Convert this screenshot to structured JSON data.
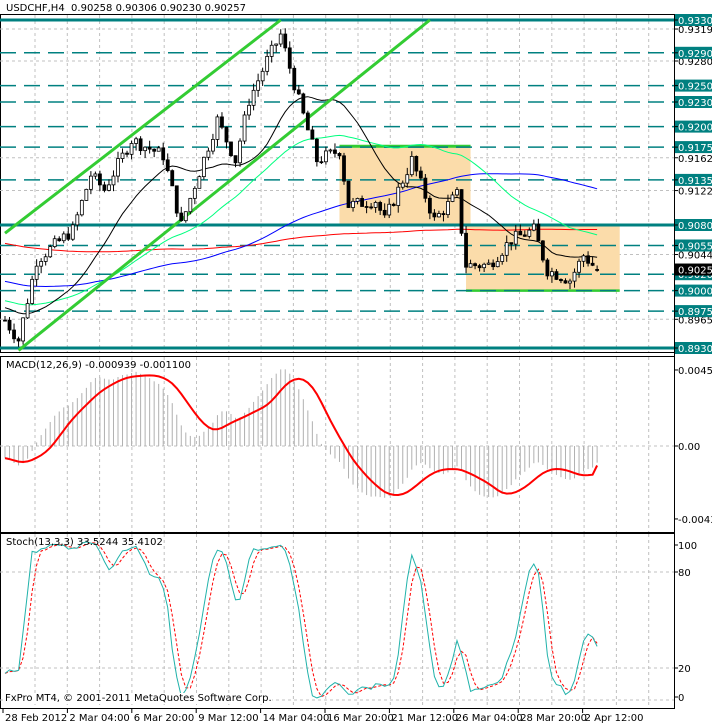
{
  "header": {
    "symbol": "USDCHF,H4",
    "ohlc": "0.90258 0.90306 0.90230 0.90257"
  },
  "macd_label": "MACD(12,26,9) -0.000939 -0.001100",
  "stoch_label": "Stoch(13,3,3) 33.5244 35.4102",
  "copyright": "FxPro MT4, © 2001-2011 MetaQuotes Software Corp.",
  "colors": {
    "level": "#008080",
    "channel": "#33cc33",
    "box": "#fbdcaa",
    "ma_fast": "#000000",
    "ma_mid": "#00ff7f",
    "ma_slow": "#0000ff",
    "ma_slowest": "#ff0000",
    "macd_signal": "#ff0000",
    "stoch_main": "#20b2aa",
    "stoch_signal": "#ff0000"
  },
  "chart_data": [
    {
      "type": "candlestick",
      "title": "USDCHF,H4",
      "last_bar": {
        "open": 0.90258,
        "high": 0.90306,
        "low": 0.9023,
        "close": 0.90257
      },
      "ylim": [
        0.893,
        0.933
      ],
      "x_tick_labels": [
        "28 Feb 2012",
        "2 Mar 04:00",
        "6 Mar 20:00",
        "9 Mar 12:00",
        "14 Mar 04:00",
        "16 Mar 20:00",
        "21 Mar 12:00",
        "26 Mar 04:00",
        "28 Mar 20:00",
        "2 Apr 12:00"
      ],
      "close_path": [
        [
          0,
          0.8964
        ],
        [
          3,
          0.894
        ],
        [
          7,
          0.9037
        ],
        [
          15,
          0.9074
        ],
        [
          19,
          0.9141
        ],
        [
          22,
          0.9123
        ],
        [
          28,
          0.9184
        ],
        [
          35,
          0.9165
        ],
        [
          39,
          0.908
        ],
        [
          42,
          0.9129
        ],
        [
          47,
          0.9208
        ],
        [
          51,
          0.9159
        ],
        [
          54,
          0.9232
        ],
        [
          58,
          0.9281
        ],
        [
          61,
          0.9312
        ],
        [
          65,
          0.9232
        ],
        [
          69,
          0.9159
        ],
        [
          74,
          0.9171
        ],
        [
          76,
          0.9104
        ],
        [
          82,
          0.911
        ],
        [
          84,
          0.9086
        ],
        [
          90,
          0.9159
        ],
        [
          95,
          0.9086
        ],
        [
          100,
          0.9117
        ],
        [
          102,
          0.9031
        ],
        [
          107,
          0.9031
        ],
        [
          112,
          0.9062
        ],
        [
          117,
          0.9074
        ],
        [
          120,
          0.9025
        ],
        [
          125,
          0.9013
        ],
        [
          128,
          0.9043
        ],
        [
          131,
          0.90257
        ]
      ],
      "level_labels": [
        "0.93300",
        "0.92900",
        "0.92500",
        "0.92300",
        "0.92000",
        "0.91750",
        "0.91350",
        "0.90800",
        "0.90550",
        "0.90200",
        "0.90000",
        "0.89750",
        "0.89300"
      ],
      "grid_labels": [
        "0.93190",
        "0.92800",
        "0.91620",
        "0.91220",
        "0.90440",
        "0.89650"
      ],
      "levels": [
        {
          "price": 0.933,
          "style": "solid"
        },
        {
          "price": 0.929,
          "style": "dash"
        },
        {
          "price": 0.925,
          "style": "dash"
        },
        {
          "price": 0.923,
          "style": "dash"
        },
        {
          "price": 0.92,
          "style": "dash"
        },
        {
          "price": 0.9175,
          "style": "dash"
        },
        {
          "price": 0.9135,
          "style": "dash"
        },
        {
          "price": 0.908,
          "style": "solid"
        },
        {
          "price": 0.9055,
          "style": "dash"
        },
        {
          "price": 0.902,
          "style": "dash"
        },
        {
          "price": 0.9,
          "style": "dash"
        },
        {
          "price": 0.8975,
          "style": "dash"
        },
        {
          "price": 0.893,
          "style": "solid"
        }
      ],
      "channels": [
        {
          "from": [
            0,
            0.907
          ],
          "to": [
            61,
            0.933
          ]
        },
        {
          "from": [
            3,
            0.8927
          ],
          "to": [
            94,
            0.933
          ]
        }
      ],
      "boxes": [
        {
          "from_bar": 74,
          "to_bar": 103,
          "top": 0.9176,
          "bottom": 0.908
        },
        {
          "from_bar": 102,
          "to_bar": 136,
          "top": 0.908,
          "bottom": 0.9
        }
      ]
    },
    {
      "type": "macd",
      "title": "MACD(12,26,9)",
      "main": -0.000939,
      "signal": -0.0011,
      "ylim": [
        -0.00434,
        0.00457
      ],
      "tick_labels": [
        "0.00457",
        "0.00",
        "-0.00434"
      ]
    },
    {
      "type": "stochastic",
      "title": "Stoch(13,3,3)",
      "main": 33.5244,
      "signal": 35.4102,
      "ylim": [
        0,
        100
      ],
      "tick_labels": [
        "100",
        "80",
        "20",
        "0"
      ]
    }
  ]
}
